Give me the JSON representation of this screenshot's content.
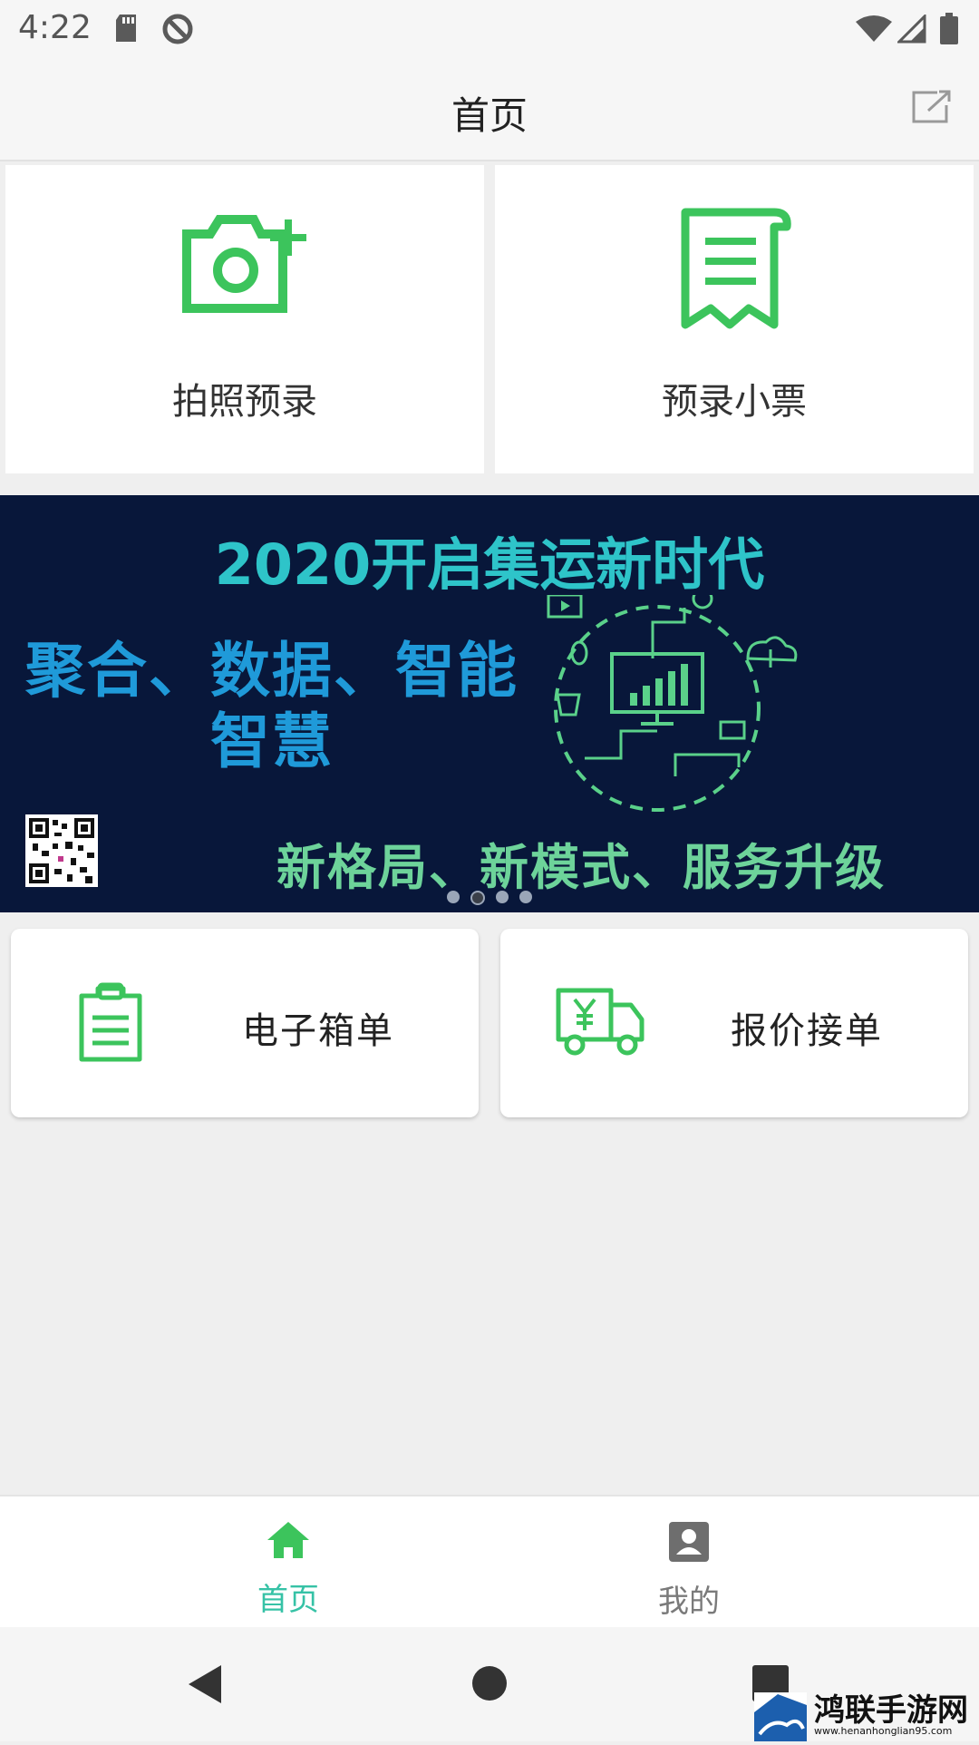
{
  "status_bar": {
    "time": "4:22",
    "icons_left": [
      "sd-card-icon",
      "do-not-disturb-icon"
    ],
    "icons_right": [
      "wifi-icon",
      "signal-icon",
      "battery-icon"
    ]
  },
  "header": {
    "title": "首页",
    "action_icon": "share-icon"
  },
  "quick_tiles": [
    {
      "label": "拍照预录",
      "icon": "camera-plus-icon"
    },
    {
      "label": "预录小票",
      "icon": "receipt-icon"
    }
  ],
  "banner": {
    "headline": "2020开启集运新时代",
    "line1": "聚合、数据、智能",
    "line2": "智慧",
    "bottom_text": "新格局、新模式、服务升级",
    "page_count": 4,
    "active_page": 2
  },
  "cards": [
    {
      "label": "电子箱单",
      "icon": "clipboard-icon"
    },
    {
      "label": "报价接单",
      "icon": "delivery-truck-yuan-icon"
    }
  ],
  "bottom_nav": {
    "items": [
      {
        "label": "首页",
        "icon": "home-icon",
        "active": true
      },
      {
        "label": "我的",
        "icon": "account-box-icon",
        "active": false
      }
    ]
  },
  "watermark": {
    "title": "鸿联手游网",
    "url": "www.henanhonglian95.com"
  },
  "colors": {
    "accent_green": "#3cc45c",
    "nav_active": "#36c2a6",
    "nav_inactive": "#7a7a7a",
    "banner_bg": "#08173a"
  }
}
